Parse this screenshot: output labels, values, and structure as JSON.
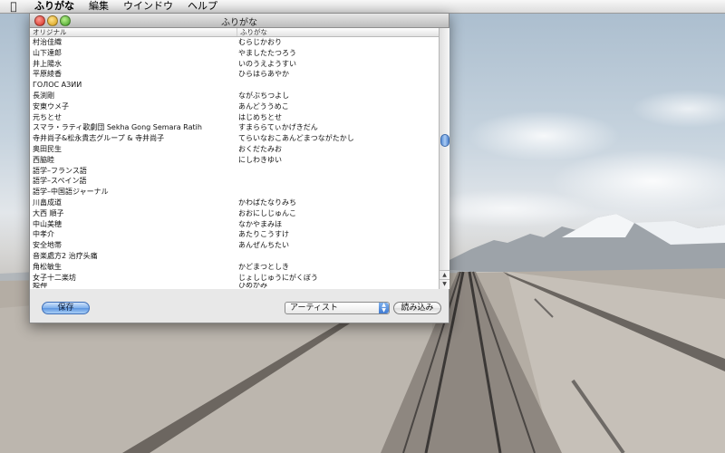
{
  "menubar": {
    "apple_icon": "apple-logo",
    "items": [
      "ふりがな",
      "編集",
      "ウインドウ",
      "ヘルプ"
    ]
  },
  "window": {
    "title": "ふりがな",
    "columns": [
      "オリジナル",
      "ふりがな"
    ],
    "rows": [
      {
        "original": "村治佳織",
        "furigana": "むらじかおり"
      },
      {
        "original": "山下達郎",
        "furigana": "やましたたつろう"
      },
      {
        "original": "井上陽水",
        "furigana": "いのうえようすい"
      },
      {
        "original": "平原綾香",
        "furigana": "ひらはらあやか"
      },
      {
        "original": "ГОЛОС АЗИИ",
        "furigana": ""
      },
      {
        "original": "長渕剛",
        "furigana": "ながぶちつよし"
      },
      {
        "original": "安東ウメ子",
        "furigana": "あんどううめこ"
      },
      {
        "original": "元ちとせ",
        "furigana": "はじめちとせ"
      },
      {
        "original": "スマラ・ラティ歌劇団 Sekha Gong Semara Ratih",
        "furigana": "すまららてぃかげきだん"
      },
      {
        "original": "寺井尚子&松永貴志グループ & 寺井尚子",
        "furigana": "てらいなおこあんどまつながたかし"
      },
      {
        "original": "奥田民生",
        "furigana": "おくだたみお"
      },
      {
        "original": "西脇睦",
        "furigana": "にしわきゆい"
      },
      {
        "original": "語学–フランス語",
        "furigana": ""
      },
      {
        "original": "語学–スペイン語",
        "furigana": ""
      },
      {
        "original": "語学–中国語ジャーナル",
        "furigana": ""
      },
      {
        "original": "川畠成道",
        "furigana": "かわばたなりみち"
      },
      {
        "original": "大西 順子",
        "furigana": "おおにしじゅんこ"
      },
      {
        "original": "中山美穂",
        "furigana": "なかやまみほ"
      },
      {
        "original": "中孝介",
        "furigana": "あたりこうすけ"
      },
      {
        "original": "安全地帯",
        "furigana": "あんぜんちたい"
      },
      {
        "original": "音楽處方2 治疗头痛",
        "furigana": ""
      },
      {
        "original": "角松敏生",
        "furigana": "かどまつとしき"
      },
      {
        "original": "女子十二楽坊",
        "furigana": "じょしじゅうにがくぼう"
      },
      {
        "original": "姫神",
        "furigana": "ひめがみ"
      }
    ],
    "save_button": "保存",
    "mode_select": "アーティスト",
    "load_button": "読み込み"
  }
}
